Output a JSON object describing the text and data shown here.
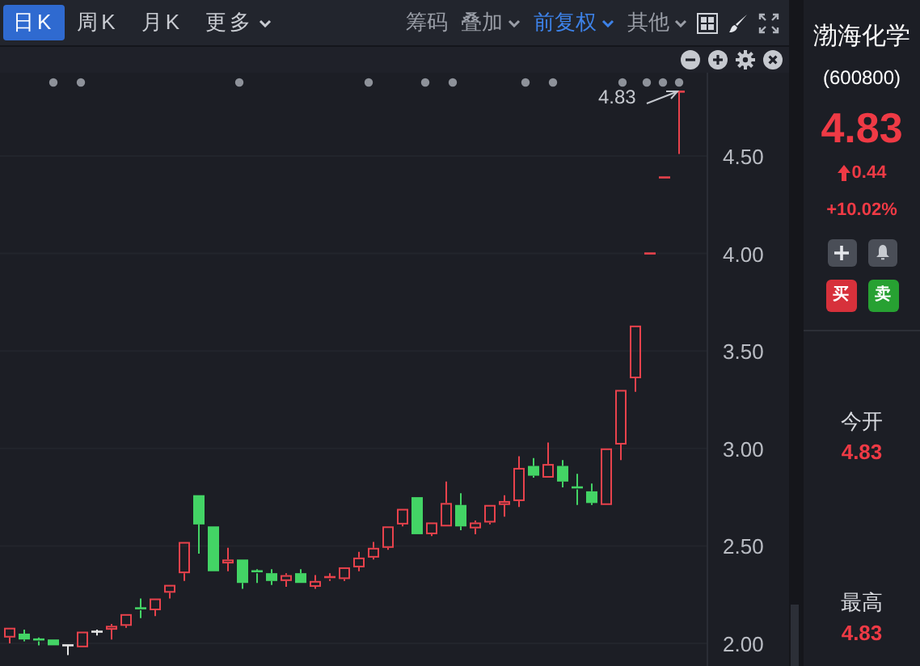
{
  "toolbar": {
    "periods": [
      {
        "label": "日K",
        "selected": true,
        "dropdown": false
      },
      {
        "label": "周K",
        "selected": false,
        "dropdown": false
      },
      {
        "label": "月K",
        "selected": false,
        "dropdown": false
      },
      {
        "label": "更多",
        "selected": false,
        "dropdown": true
      }
    ],
    "options": [
      {
        "label": "筹码",
        "selected": false,
        "dropdown": false
      },
      {
        "label": "叠加",
        "selected": false,
        "dropdown": true
      },
      {
        "label": "前复权",
        "selected": true,
        "dropdown": true
      },
      {
        "label": "其他",
        "selected": false,
        "dropdown": true
      }
    ]
  },
  "chart": {
    "last_price_label": "4.83",
    "price_axis": [
      "4.50",
      "4.00",
      "3.50",
      "3.00",
      "2.50",
      "2.00"
    ]
  },
  "quote": {
    "name": "渤海化学",
    "code": "(600800)",
    "price": "4.83",
    "change": "0.44",
    "change_percent": "+10.02%",
    "trade_buttons": [
      {
        "label": "买",
        "kind": "buy"
      },
      {
        "label": "卖",
        "kind": "sell"
      }
    ],
    "stats": [
      {
        "label": "今开",
        "value": "4.83"
      },
      {
        "label": "最高",
        "value": "4.83"
      }
    ]
  }
}
